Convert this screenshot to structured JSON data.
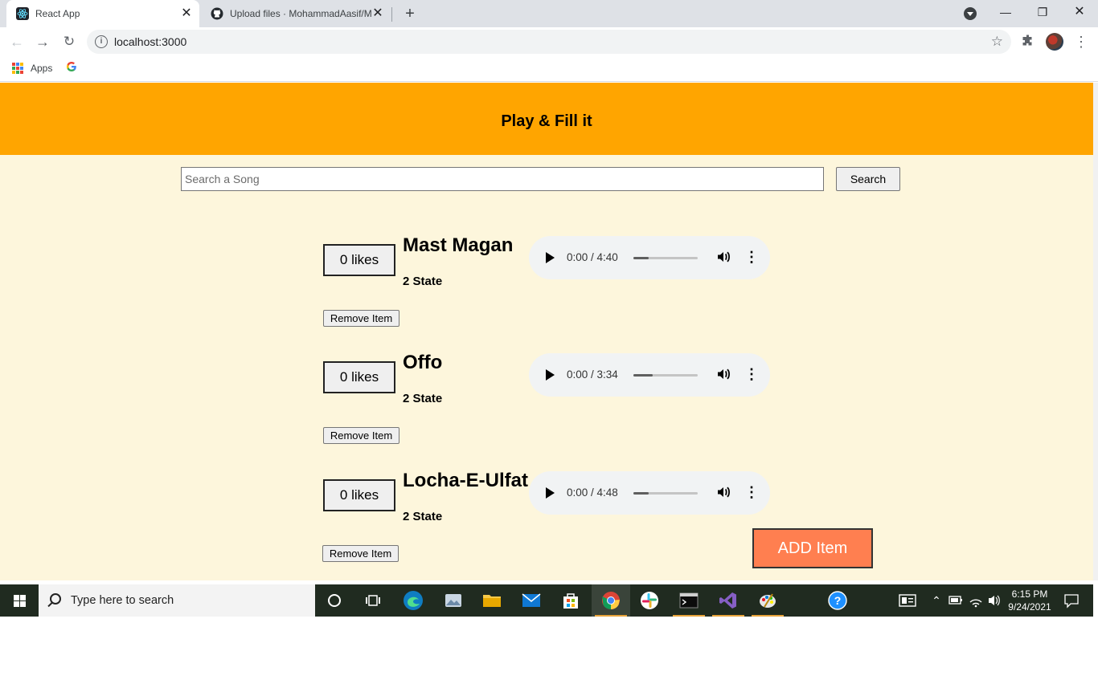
{
  "browser": {
    "tabs": [
      {
        "title": "React App",
        "active": true
      },
      {
        "title": "Upload files · MohammadAasif/M",
        "active": false
      }
    ],
    "url": "localhost:3000",
    "bookmarks": {
      "apps_label": "Apps",
      "google_letter": "G"
    }
  },
  "app": {
    "title": "Play & Fill it",
    "search": {
      "placeholder": "Search a Song",
      "value": "",
      "button_label": "Search"
    },
    "songs": [
      {
        "likes": "0 likes",
        "name": "Mast Magan",
        "state": "2 State",
        "time": "0:00 / 4:40",
        "progress": 0.24,
        "remove_label": "Remove Item"
      },
      {
        "likes": "0 likes",
        "name": "Offo",
        "state": "2 State",
        "time": "0:00 / 3:34",
        "progress": 0.3,
        "remove_label": "Remove Item"
      },
      {
        "likes": "0 likes",
        "name": "Locha-E-Ulfat",
        "state": "2 State",
        "time": "0:00 / 4:48",
        "progress": 0.24,
        "remove_label": "Remove Item"
      }
    ],
    "add_label": "ADD Item"
  },
  "taskbar": {
    "search_placeholder": "Type here to search",
    "clock_time": "6:15 PM",
    "clock_date": "9/24/2021"
  },
  "colors": {
    "header": "#ffa500",
    "page_bg": "#fdf6dc",
    "add_button": "#ff7f50",
    "taskbar": "#202b20"
  }
}
